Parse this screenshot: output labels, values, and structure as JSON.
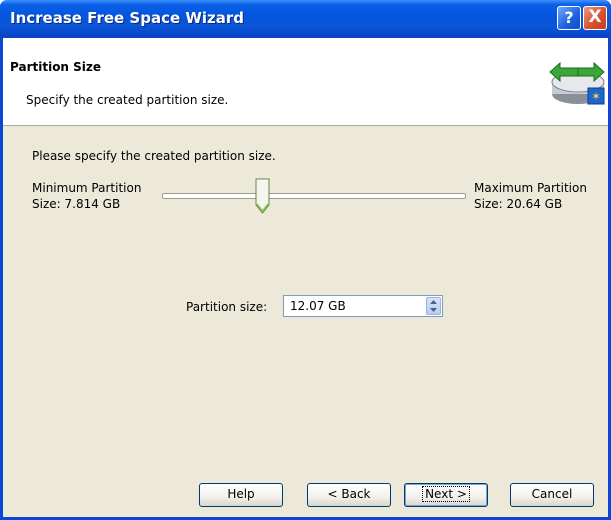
{
  "window": {
    "title": "Increase Free Space Wizard"
  },
  "title_buttons": {
    "help": "?",
    "close": "X"
  },
  "header": {
    "title": "Partition Size",
    "subtitle": "Specify the created partition size."
  },
  "body": {
    "instruction": "Please specify the created partition size.",
    "min_label_line1": "Minimum Partition",
    "min_label_line2": "Size: 7.814 GB",
    "max_label_line1": "Maximum Partition",
    "max_label_line2": "Size: 20.64 GB",
    "slider": {
      "min_gb": 7.814,
      "max_gb": 20.64,
      "value_gb": 12.07
    },
    "partition_size_label": "Partition size:",
    "partition_size_value": "12.07 GB"
  },
  "buttons": {
    "help": "Help",
    "back": "< Back",
    "next": "Next >",
    "cancel": "Cancel"
  }
}
